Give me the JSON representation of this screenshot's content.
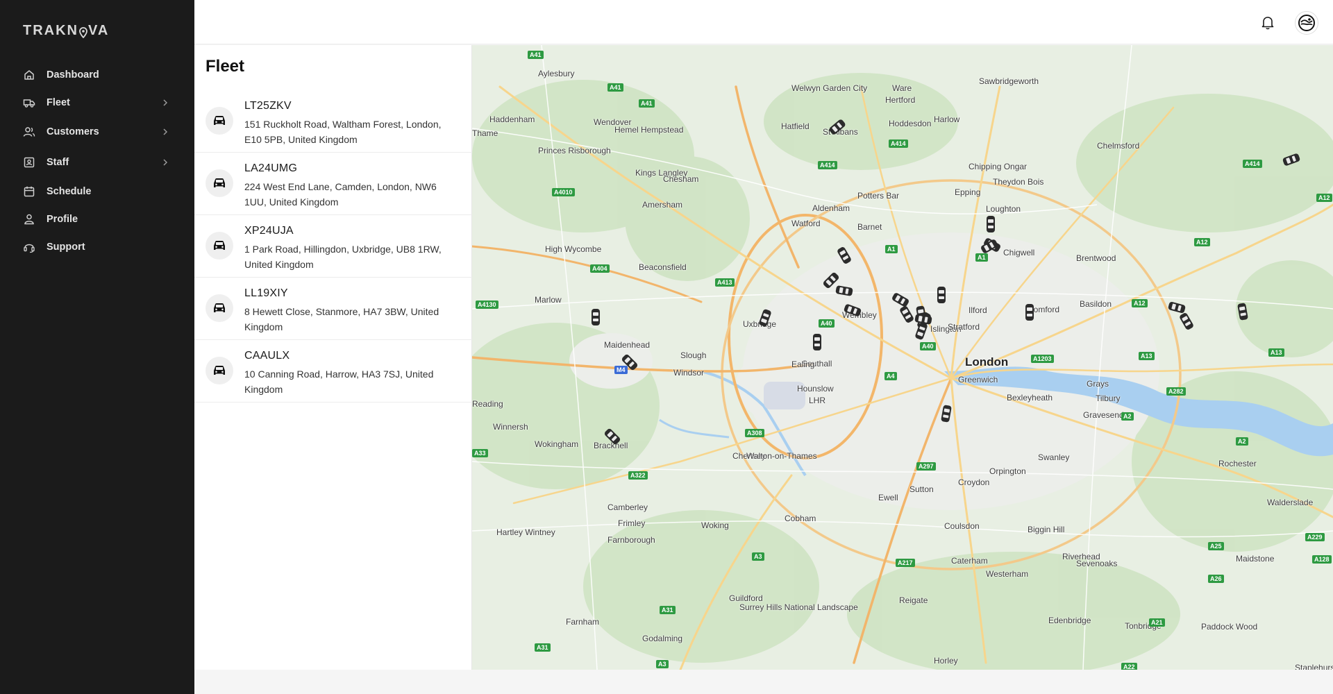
{
  "app": {
    "logo": "TRAKNOVA"
  },
  "nav": [
    {
      "label": "Dashboard",
      "icon": "home-icon",
      "has_children": false
    },
    {
      "label": "Fleet",
      "icon": "truck-icon",
      "has_children": true
    },
    {
      "label": "Customers",
      "icon": "users-icon",
      "has_children": true
    },
    {
      "label": "Staff",
      "icon": "id-card-icon",
      "has_children": true
    },
    {
      "label": "Schedule",
      "icon": "calendar-icon",
      "has_children": false
    },
    {
      "label": "Profile",
      "icon": "user-icon",
      "has_children": false
    },
    {
      "label": "Support",
      "icon": "headset-icon",
      "has_children": false
    }
  ],
  "header": {
    "notification_icon": "bell-icon",
    "avatar_icon": "avatar-icon"
  },
  "fleet": {
    "title": "Fleet",
    "vehicles": [
      {
        "plate": "LT25ZKV",
        "address": "151 Ruckholt Road, Waltham Forest, London, E10 5PB, United Kingdom"
      },
      {
        "plate": "LA24UMG",
        "address": "224 West End Lane, Camden, London, NW6 1UU, United Kingdom"
      },
      {
        "plate": "XP24UJA",
        "address": "1 Park Road, Hillingdon, Uxbridge, UB8 1RW, United Kingdom"
      },
      {
        "plate": "LL19XIY",
        "address": "8 Hewett Close, Stanmore, HA7 3BW, United Kingdom"
      },
      {
        "plate": "CAAULX",
        "address": "10 Canning Road, Harrow, HA3 7SJ, United Kingdom"
      }
    ]
  },
  "map": {
    "places": [
      "Aylesbury",
      "Haddenham",
      "Wendover",
      "Thame",
      "Princes Risborough",
      "Hemel Hempstead",
      "St Albans",
      "Welwyn Garden City",
      "Hatfield",
      "Ware",
      "Hertford",
      "Hoddesdon",
      "Harlow",
      "Sawbridgeworth",
      "Chelmsford",
      "Chipping Ongar",
      "Epping",
      "Theydon Bois",
      "Potters Bar",
      "Kings Langley",
      "Chesham",
      "Amersham",
      "Aldenham",
      "Watford",
      "Barnet",
      "Loughton",
      "Chigwell",
      "Brentwood",
      "High Wycombe",
      "Beaconsfield",
      "Marlow",
      "Maidenhead",
      "Slough",
      "Uxbridge",
      "Southall",
      "Ealing",
      "Wembley",
      "Islington",
      "Stratford",
      "Ilford",
      "Romford",
      "Basildon",
      "London",
      "Greenwich",
      "Bexleyheath",
      "Grays",
      "Tilbury",
      "Gravesend",
      "Windsor",
      "Hounslow",
      "LHR",
      "Reading",
      "Winnersh",
      "Wokingham",
      "Bracknell",
      "Chertsey",
      "Walton-on-Thames",
      "Sutton",
      "Croydon",
      "Orpington",
      "Swanley",
      "Rochester",
      "Camberley",
      "Frimley",
      "Hartley Wintney",
      "Farnborough",
      "Woking",
      "Cobham",
      "Ewell",
      "Coulsdon",
      "Biggin Hill",
      "Caterham",
      "Westerham",
      "Riverhead",
      "Sevenoaks",
      "Maidstone",
      "Walderslade",
      "Guildford",
      "Reigate",
      "Surrey Hills National Landscape",
      "Farnham",
      "Godalming",
      "Horley",
      "Edenbridge",
      "Tonbridge",
      "Paddock Wood",
      "Staplehurst"
    ],
    "roads": [
      "A41",
      "A41",
      "A41",
      "A4010",
      "A414",
      "A414",
      "A414",
      "A12",
      "A12",
      "A1",
      "A1",
      "A404",
      "A413",
      "A4130",
      "A40",
      "A40",
      "A4",
      "M4",
      "A1203",
      "A12",
      "A13",
      "A13",
      "A282",
      "A2",
      "A2",
      "A33",
      "A322",
      "A308",
      "A297",
      "A3",
      "A217",
      "A25",
      "A21",
      "A22",
      "A31",
      "A31",
      "A3",
      "A229",
      "A26",
      "A128"
    ],
    "vehicle_count": 26
  }
}
